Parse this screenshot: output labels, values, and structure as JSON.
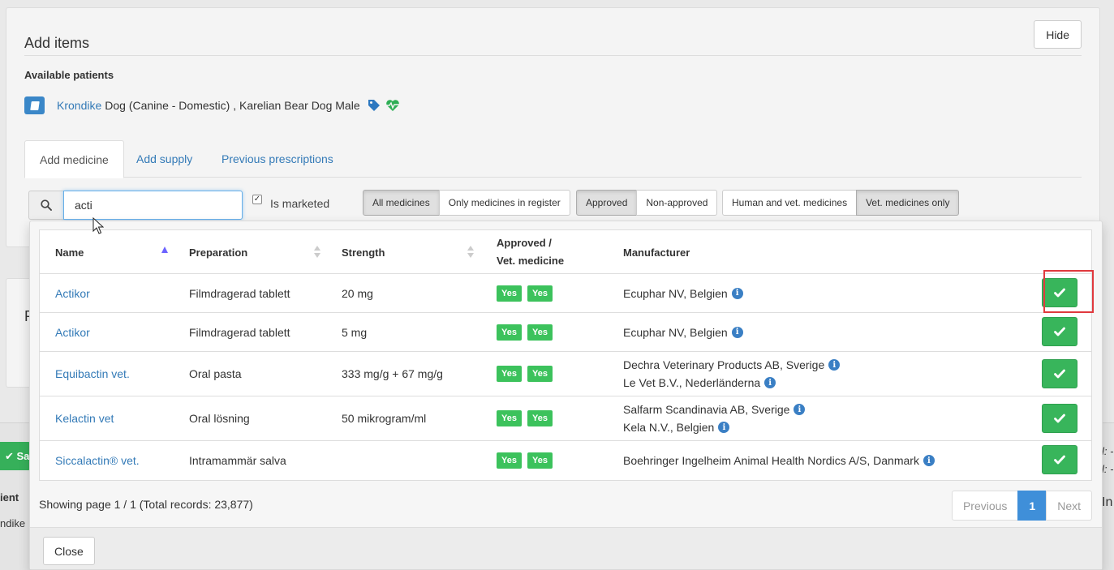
{
  "panel": {
    "title": "Add items",
    "hide_label": "Hide"
  },
  "patients": {
    "label": "Available patients",
    "name": "Krondike",
    "description": "Dog (Canine - Domestic) , Karelian Bear Dog Male"
  },
  "tabs": [
    {
      "label": "Add medicine"
    },
    {
      "label": "Add supply"
    },
    {
      "label": "Previous prescriptions"
    }
  ],
  "search": {
    "value": "acti",
    "marketed_label": "Is marketed",
    "marketed_checked": true
  },
  "filters": {
    "register": [
      "All medicines",
      "Only medicines in register"
    ],
    "approval": [
      "Approved",
      "Non-approved"
    ],
    "scope": [
      "Human and vet. medicines",
      "Vet. medicines only"
    ]
  },
  "table": {
    "headers": {
      "name": "Name",
      "preparation": "Preparation",
      "strength": "Strength",
      "approved_line1": "Approved /",
      "approved_line2": "Vet. medicine",
      "manufacturer": "Manufacturer"
    },
    "badge_label": "Yes",
    "rows": [
      {
        "name": "Actikor",
        "preparation": "Filmdragerad tablett",
        "strength": "20 mg",
        "approved": "Yes",
        "vet": "Yes",
        "manufacturers": [
          "Ecuphar NV, Belgien"
        ]
      },
      {
        "name": "Actikor",
        "preparation": "Filmdragerad tablett",
        "strength": "5 mg",
        "approved": "Yes",
        "vet": "Yes",
        "manufacturers": [
          "Ecuphar NV, Belgien"
        ]
      },
      {
        "name": "Equibactin vet.",
        "preparation": "Oral pasta",
        "strength": "333 mg/g + 67 mg/g",
        "approved": "Yes",
        "vet": "Yes",
        "manufacturers": [
          "Dechra Veterinary Products AB, Sverige",
          "Le Vet B.V., Nederländerna"
        ]
      },
      {
        "name": "Kelactin vet",
        "preparation": "Oral lösning",
        "strength": "50 mikrogram/ml",
        "approved": "Yes",
        "vet": "Yes",
        "manufacturers": [
          "Salfarm Scandinavia AB, Sverige",
          "Kela N.V., Belgien"
        ]
      },
      {
        "name": "Siccalactin® vet.",
        "preparation": "Intramammär salva",
        "strength": "",
        "approved": "Yes",
        "vet": "Yes",
        "manufacturers": [
          "Boehringer Ingelheim Animal Health Nordics A/S, Danmark"
        ]
      }
    ]
  },
  "pagination": {
    "summary": "Showing page 1 / 1 (Total records: 23,877)",
    "previous": "Previous",
    "current": "1",
    "next": "Next"
  },
  "close_label": "Close",
  "background": {
    "save_fragment": "Sa",
    "fragment_1": "P",
    "fragment_2": "ient",
    "fragment_3": "ndike",
    "fragment_4": "l: -",
    "fragment_5": "l: -",
    "fragment_6": "In"
  },
  "colors": {
    "accent": "#337ab7",
    "success": "#38b55b",
    "highlight": "#e0393e",
    "page_active": "#3f8fd9"
  }
}
